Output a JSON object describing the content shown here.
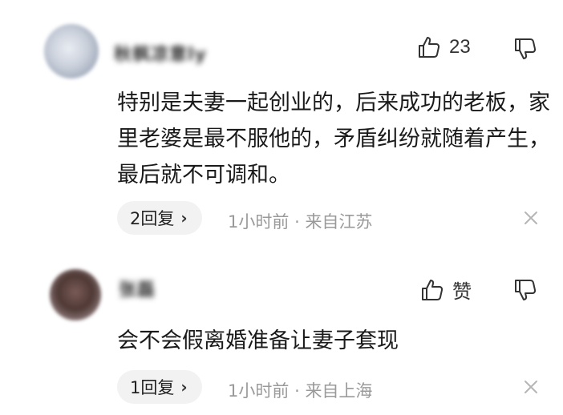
{
  "comments": [
    {
      "username": "秋枫凉意ly",
      "like_icon": "thumbs-up-icon",
      "like_count": "23",
      "dislike_icon": "thumbs-down-icon",
      "text": "特别是夫妻一起创业的，后来成功的老板，家里老婆是最不服他的，矛盾纠纷就随着产生，最后就不可调和。",
      "reply_label": "2回复",
      "reply_chevron": "›",
      "time": "1小时前",
      "separator": "·",
      "location": "来自江苏",
      "close_icon": "close-icon"
    },
    {
      "username": "张磊",
      "like_icon": "thumbs-up-icon",
      "like_count": "赞",
      "dislike_icon": "thumbs-down-icon",
      "text": "会不会假离婚准备让妻子套现",
      "reply_label": "1回复",
      "reply_chevron": "›",
      "time": "1小时前",
      "separator": "·",
      "location": "来自上海",
      "close_icon": "close-icon"
    }
  ]
}
